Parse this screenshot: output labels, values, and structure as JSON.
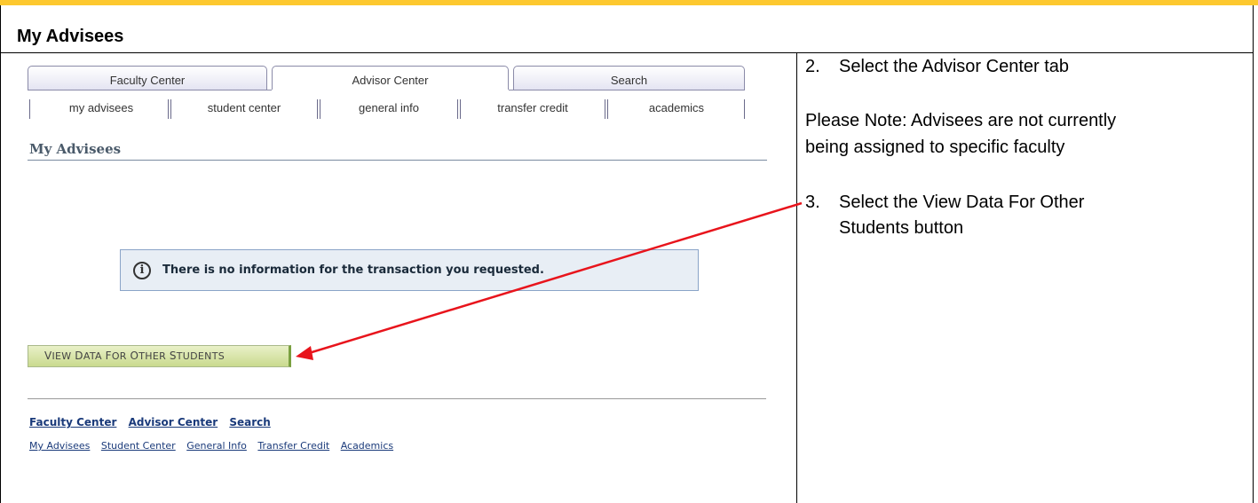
{
  "document": {
    "header_title": "My Advisees",
    "accent_color": "#fdc82f"
  },
  "tabs": [
    {
      "label": "Faculty Center",
      "active": false
    },
    {
      "label": "Advisor Center",
      "active": true
    },
    {
      "label": "Search",
      "active": false
    }
  ],
  "subtabs": [
    {
      "label": "my advisees",
      "active": true
    },
    {
      "label": "student center",
      "active": false
    },
    {
      "label": "general info",
      "active": false
    },
    {
      "label": "transfer credit",
      "active": false
    },
    {
      "label": "academics",
      "active": false
    }
  ],
  "page": {
    "heading": "My Advisees",
    "info_message": "There is no information for the transaction you requested.",
    "info_icon": "info-icon",
    "view_button_label": "View Data For Other Students"
  },
  "footer": {
    "primary_links": [
      "Faculty Center",
      "Advisor Center",
      "Search"
    ],
    "secondary_links": [
      "My Advisees",
      "Student Center",
      "General Info",
      "Transfer Credit",
      "Academics"
    ]
  },
  "instructions": {
    "step2_num": "2.",
    "step2_text": "Select the Advisor Center tab",
    "note_line1": "Please Note: Advisees are not currently",
    "note_line2": "being assigned to specific faculty",
    "step3_num": "3.",
    "step3_line1": "Select the View Data For Other",
    "step3_line2": "Students button",
    "arrow_color": "#e8141c"
  }
}
